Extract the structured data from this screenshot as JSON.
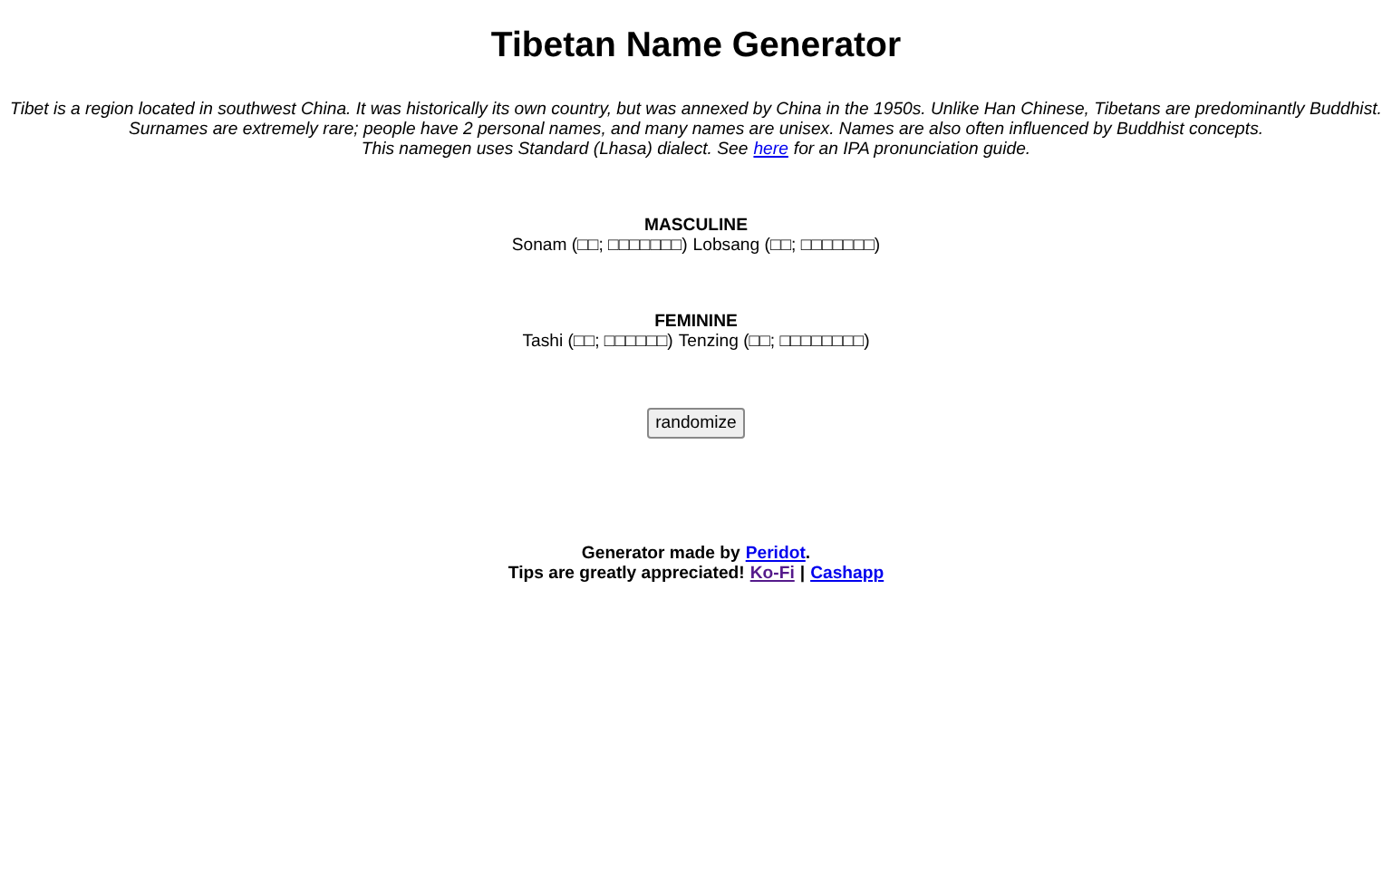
{
  "title": "Tibetan Name Generator",
  "intro": [
    "Tibet is a region located in southwest China. It was historically its own country, but was annexed by China in the 1950s. Unlike Han Chinese, Tibetans are predominantly Buddhist.",
    "Surnames are extremely rare; people have 2 personal names, and many names are unisex. Names are also often influenced by Buddhist concepts."
  ],
  "guide": {
    "before": "This namegen uses Standard (Lhasa) dialect. See",
    "link": "here",
    "after": "for an IPA pronunciation guide."
  },
  "sections": [
    {
      "heading": "MASCULINE",
      "names": [
        "Sonam (□□; □□□□□□□)",
        "Lobsang (□□; □□□□□□□)"
      ]
    },
    {
      "heading": "FEMININE",
      "names": [
        "Tashi (□□; □□□□□□)",
        "Tenzing (□□; □□□□□□□□)"
      ]
    }
  ],
  "button": "randomize",
  "footer": {
    "credit": "Generator made by",
    "author": "Peridot",
    "author_end": ".",
    "tips": "Tips are greatly appreciated!",
    "links": [
      {
        "label": "Ko-Fi",
        "visited": true
      },
      {
        "label": "Cashapp",
        "visited": false
      }
    ],
    "separator": "|"
  }
}
